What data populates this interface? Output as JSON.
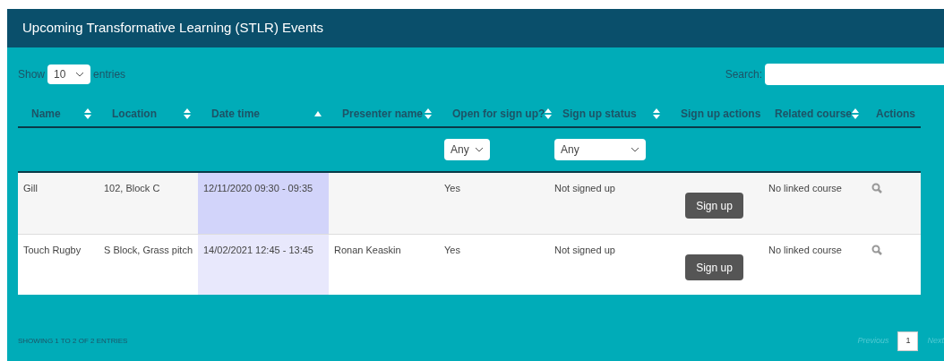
{
  "panel": {
    "title": "Upcoming Transformative Learning (STLR) Events"
  },
  "length_control": {
    "before": "Show",
    "value": "10",
    "after": "entries"
  },
  "search": {
    "label": "Search:"
  },
  "table": {
    "columns": [
      {
        "label": "Name",
        "sorted": false
      },
      {
        "label": "Location",
        "sorted": false
      },
      {
        "label": "Date time",
        "sorted": true
      },
      {
        "label": "Presenter name",
        "sorted": false
      },
      {
        "label": "Open for sign up?",
        "sorted": false,
        "filter": "Any"
      },
      {
        "label": "Sign up status",
        "sorted": false,
        "filter": "Any"
      },
      {
        "label": "Sign up actions"
      },
      {
        "label": "Related course",
        "sorted": false
      },
      {
        "label": "Actions"
      }
    ],
    "rows": [
      {
        "name": "Gill",
        "location": "102, Block C",
        "date_time": "12/11/2020 09:30 - 09:35",
        "open": "Yes",
        "status": "Not signed up",
        "action": "Sign up",
        "course": "No linked course"
      },
      {
        "name": "Touch Rugby",
        "location": "S Block, Grass pitch",
        "date_time": "14/02/2021 12:45 - 13:45",
        "presenter": "Ronan Keaskin",
        "open": "Yes",
        "status": "Not signed up",
        "action": "Sign up",
        "course": "No linked course"
      }
    ]
  },
  "info": "SHOWING 1 TO 2 OF 2 ENTRIES",
  "pagination": [
    {
      "label": "Previous",
      "kind": "nav",
      "disabled": true
    },
    {
      "label": "1",
      "kind": "page",
      "selected": true
    },
    {
      "label": "Next",
      "kind": "nav",
      "disabled": true
    }
  ]
}
